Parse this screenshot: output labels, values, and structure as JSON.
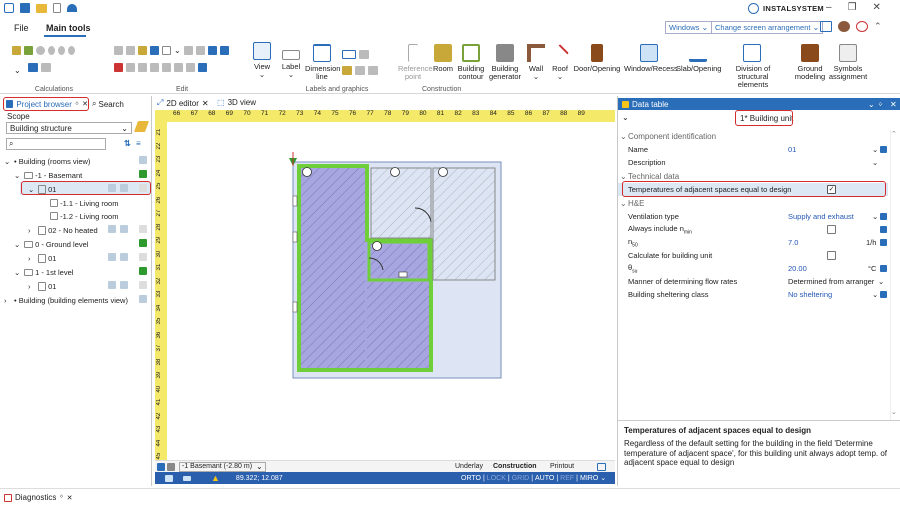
{
  "app": {
    "title": "INSTALSYSTEM",
    "brand_color": "#2a6db8",
    "accent_green": "#2e9a2e"
  },
  "menu": {
    "file": "File",
    "main_tools": "Main tools",
    "windows": "Windows",
    "change_screen": "Change screen arrangement"
  },
  "ribbon": {
    "groups": {
      "calculations": "Calculations",
      "edit": "Edit",
      "labels_graphics": "Labels and graphics",
      "construction": "Construction"
    },
    "view": "View",
    "label": "Label",
    "dimension_line": "Dimension line",
    "reference_point": "Reference point",
    "room": "Room",
    "building_contour": "Building contour",
    "building_generator": "Building generator",
    "wall": "Wall",
    "roof": "Roof",
    "door_opening": "Door/Opening",
    "window_recess": "Window/Recess",
    "slab_opening": "Slab/Opening",
    "division": "Division of structural elements",
    "ground_modeling": "Ground modeling",
    "symbols_assignment": "Symbols assignment"
  },
  "left": {
    "tab_project": "Project browser",
    "tab_search": "Search",
    "scope_label": "Scope",
    "scope_value": "Building structure",
    "tree": [
      "Building (rooms view)",
      "-1 - Basemant",
      "01",
      "-1.1 - Living room",
      "-1.2 - Living room",
      "02 - No heated",
      "0 - Ground  level",
      "01",
      "1 - 1st level",
      "01",
      "Building (building elements view)"
    ]
  },
  "canvas": {
    "tab_2d": "2D editor",
    "tab_3d": "3D view",
    "level_select": "-1 Basemant (-2.80 m)",
    "underlay": "Underlay",
    "construction": "Construction",
    "printout": "Printout",
    "coords": "89.322; 12.087",
    "modes": [
      "ORTO",
      "LOCK",
      "GRID",
      "AUTO",
      "REF",
      "MIRO"
    ],
    "ruler_h": [
      "66",
      "67",
      "68",
      "69",
      "70",
      "71",
      "72",
      "73",
      "74",
      "75",
      "76",
      "77",
      "78",
      "79",
      "80",
      "81",
      "82",
      "83",
      "84",
      "85",
      "86",
      "87",
      "88",
      "89"
    ],
    "ruler_v": [
      "21",
      "22",
      "23",
      "24",
      "25",
      "26",
      "27",
      "28",
      "29",
      "30",
      "31",
      "32",
      "33",
      "34",
      "35",
      "36",
      "37",
      "38",
      "39",
      "40",
      "41",
      "42",
      "43",
      "44",
      "45"
    ]
  },
  "right": {
    "title": "Data table",
    "selected": "1* Building unit",
    "sections": {
      "comp": "Component identification",
      "tech": "Technical data",
      "he": "H&E"
    },
    "props": {
      "name_label": "Name",
      "name_value": "01",
      "desc_label": "Description",
      "temps_label": "Temperatures of adjacent spaces equal to design",
      "vent_label": "Ventilation type",
      "vent_value": "Supply and exhaust",
      "always_label": "Always include n",
      "always_sub": "min",
      "n50_label": "n",
      "n50_sub": "50",
      "n50_value": "7.0",
      "n50_unit": "1/h",
      "calc_label": "Calculate for building unit",
      "theta_label": "θ",
      "theta_sub": "su",
      "theta_value": "20.00",
      "theta_unit": "°C",
      "manner_label": "Manner of determining flow rates",
      "manner_value": "Determined from arranger",
      "shelter_label": "Building sheltering class",
      "shelter_value": "No sheltering"
    },
    "help_title": "Temperatures of adjacent spaces equal to design",
    "help_text": "Regardless of the default setting for the building in the field 'Determine temperature of adjacent space', for this building unit always adopt temp. of adjacent space equal to design"
  },
  "bottom": {
    "diagnostics": "Diagnostics"
  }
}
